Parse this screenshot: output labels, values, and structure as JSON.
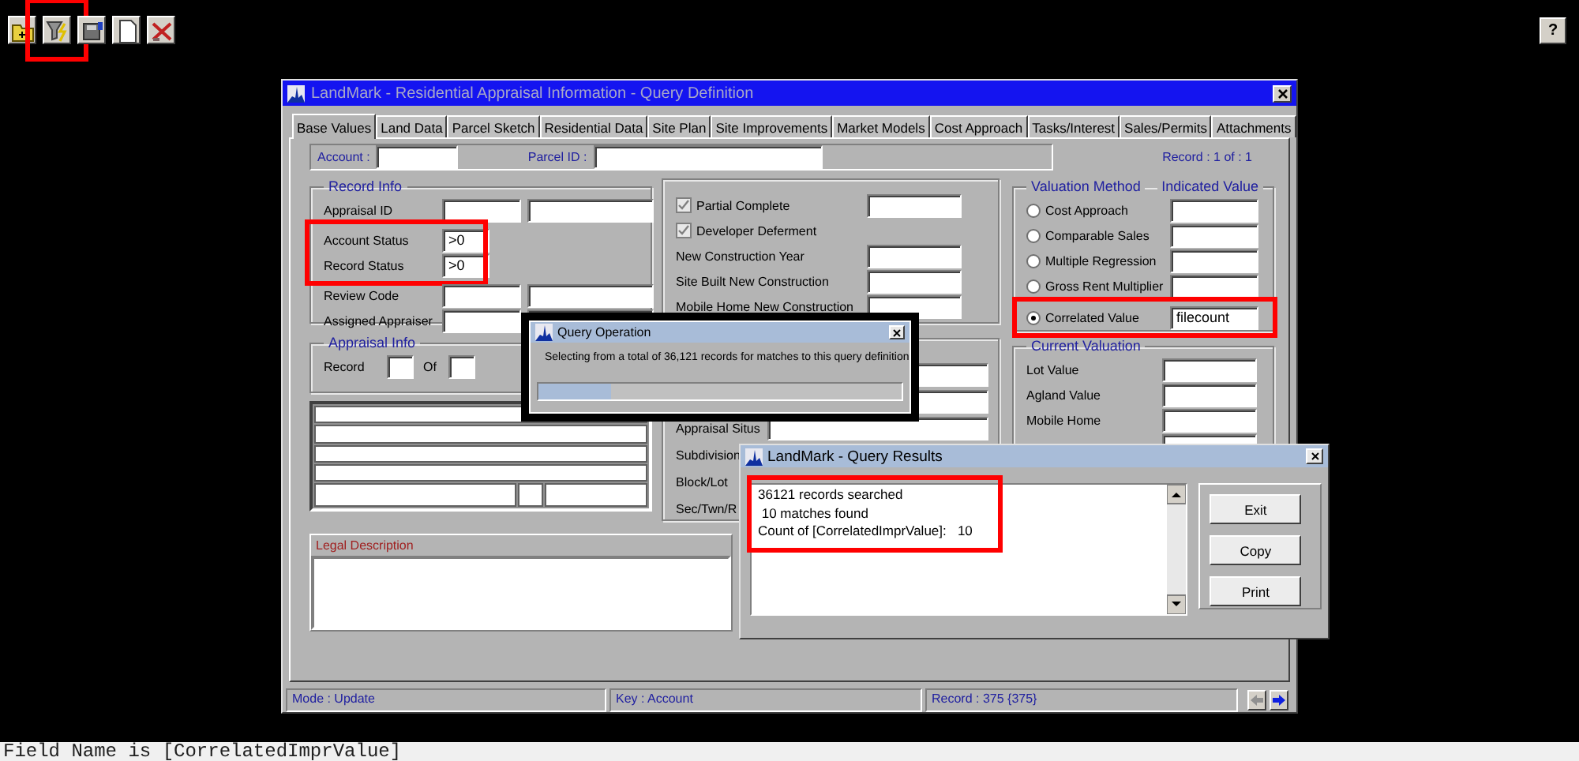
{
  "toolbar": {
    "buttons": [
      {
        "kind": "folder",
        "highlighted": false
      },
      {
        "kind": "funnel",
        "highlighted": true
      },
      {
        "kind": "disk",
        "highlighted": false
      },
      {
        "kind": "page",
        "highlighted": false
      },
      {
        "kind": "cross",
        "highlighted": false
      }
    ],
    "help_button": "?"
  },
  "main_window": {
    "title": "LandMark - Residential Appraisal Information - Query Definition",
    "tabs": [
      {
        "label": "Base Values",
        "selected": true
      },
      {
        "label": "Land Data",
        "selected": false
      },
      {
        "label": "Parcel Sketch",
        "selected": false
      },
      {
        "label": "Residential Data",
        "selected": false
      },
      {
        "label": "Site Plan",
        "selected": false
      },
      {
        "label": "Site Improvements",
        "selected": false
      },
      {
        "label": "Market Models",
        "selected": false
      },
      {
        "label": "Cost Approach",
        "selected": false
      },
      {
        "label": "Tasks/Interest",
        "selected": false
      },
      {
        "label": "Sales/Permits",
        "selected": false
      },
      {
        "label": "Attachments",
        "selected": false
      }
    ],
    "account_label": "Account :",
    "parcel_label": "Parcel ID :",
    "record_position": "Record : 1 of : 1",
    "record_info": {
      "title": "Record Info",
      "fields": [
        {
          "label": "Appraisal ID",
          "kind": "double",
          "highlighted": false
        },
        {
          "label": "Account Status",
          "kind": "short",
          "value": ">0",
          "highlighted": true
        },
        {
          "label": "Record Status",
          "kind": "short",
          "value": ">0",
          "highlighted": true
        },
        {
          "label": "Review Code",
          "kind": "double",
          "highlighted": false
        },
        {
          "label": "Assigned Appraiser",
          "kind": "double",
          "highlighted": false
        }
      ]
    },
    "construction": {
      "rows": [
        {
          "label": "Partial Complete",
          "kind": "checkbox-field",
          "checked": true
        },
        {
          "label": "Developer Deferment",
          "kind": "checkbox",
          "checked": true
        },
        {
          "label": "New Construction Year",
          "kind": "field"
        },
        {
          "label": "Site Built New Construction",
          "kind": "field"
        },
        {
          "label": "Mobile Home New Construction",
          "kind": "field"
        }
      ]
    },
    "valuation": {
      "title": "Valuation Method",
      "column_title": "Indicated Value",
      "options": [
        {
          "label": "Cost Approach",
          "selected": false,
          "highlighted": false
        },
        {
          "label": "Comparable Sales",
          "selected": false,
          "highlighted": false
        },
        {
          "label": "Multiple Regression",
          "selected": false,
          "highlighted": false
        },
        {
          "label": "Gross Rent Multiplier",
          "selected": false,
          "highlighted": false
        },
        {
          "label": "Correlated Value",
          "selected": true,
          "value": "filecount",
          "highlighted": true
        }
      ]
    },
    "appraisal_info": {
      "title": "Appraisal Info",
      "record_label": "Record",
      "of_label": "Of"
    },
    "location": {
      "rows": [
        {
          "kind": "field"
        },
        {
          "kind": "field"
        },
        {
          "label": "Appraisal Situs",
          "kind": "field"
        },
        {
          "label": "Subdivision",
          "kind": "split"
        },
        {
          "label": "Block/Lot",
          "kind": "field"
        },
        {
          "label": "Sec/Twn/R",
          "kind": "field"
        }
      ]
    },
    "current_valuation": {
      "title": "Current Valuation",
      "rows": [
        "Lot Value",
        "Agland Value",
        "Mobile Home",
        ""
      ]
    },
    "legal_description": {
      "title": "Legal Description"
    },
    "status_bar": [
      "Mode : Update",
      "Key : Account",
      "Record : 375 {375}"
    ]
  },
  "query_operation": {
    "title": "Query Operation",
    "message": "Selecting from a total of 36,121 records for matches to this query definition",
    "level": 0.2
  },
  "query_results": {
    "title": "LandMark - Query Results",
    "highlighted": true,
    "lines": [
      "36121 records searched",
      " 10 matches found",
      "Count of [CorrelatedImprValue]:   10"
    ],
    "buttons": [
      "Exit",
      "Copy",
      "Print"
    ]
  },
  "field_hint": "Field Name is [CorrelatedImprValue]"
}
